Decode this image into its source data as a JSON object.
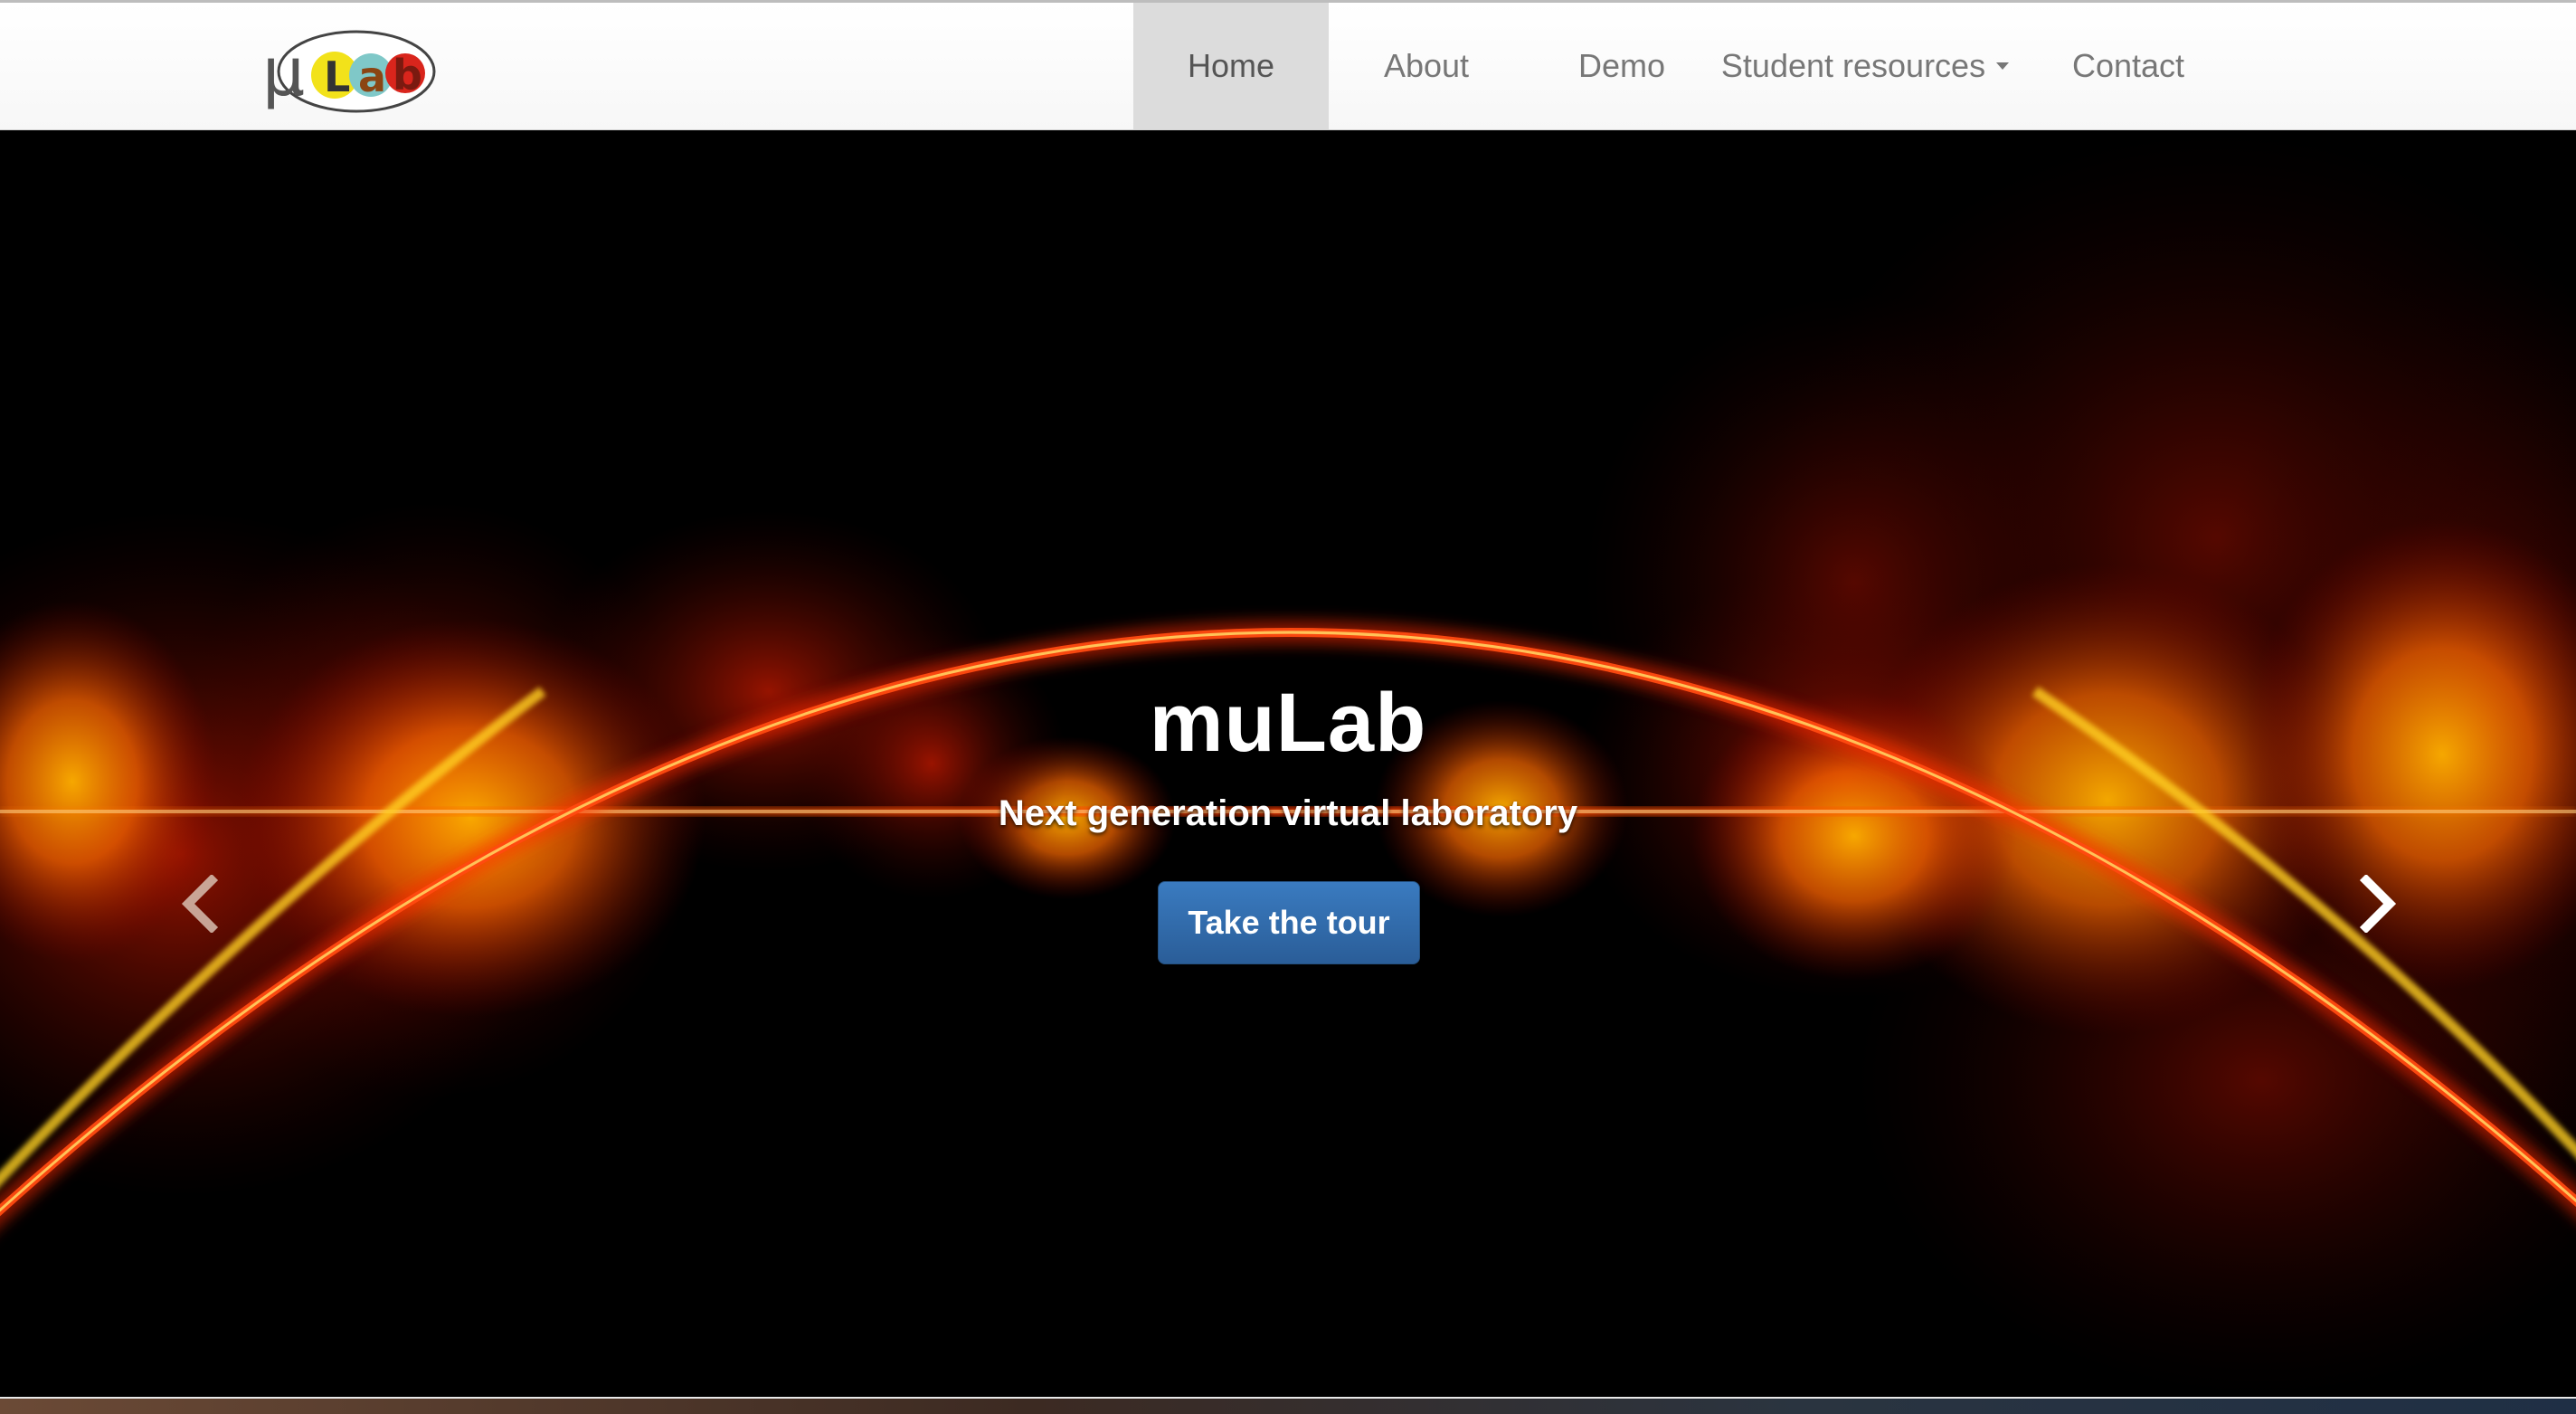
{
  "brand": {
    "logo_text_mu": "μ",
    "logo_letters": [
      "L",
      "a",
      "b"
    ],
    "logo_colors": {
      "L": "#f2e21a",
      "a": "#7fc8c8",
      "b": "#d9251c",
      "mu": "#555555"
    }
  },
  "nav": {
    "items": [
      {
        "label": "Home",
        "active": true
      },
      {
        "label": "About",
        "active": false
      },
      {
        "label": "Demo",
        "active": false
      },
      {
        "label": "Student resources",
        "active": false,
        "dropdown": true
      },
      {
        "label": "Contact",
        "active": false
      }
    ]
  },
  "hero": {
    "title": "muLab",
    "subtitle": "Next generation virtual laboratory",
    "button_label": "Take the tour",
    "prev_icon": "chevron-left-icon",
    "next_icon": "chevron-right-icon",
    "slides_total": 3,
    "slide_active": 1
  },
  "colors": {
    "button": "#2f6aad",
    "nav_active_bg": "#dcdcdc",
    "nav_text": "#777777"
  }
}
